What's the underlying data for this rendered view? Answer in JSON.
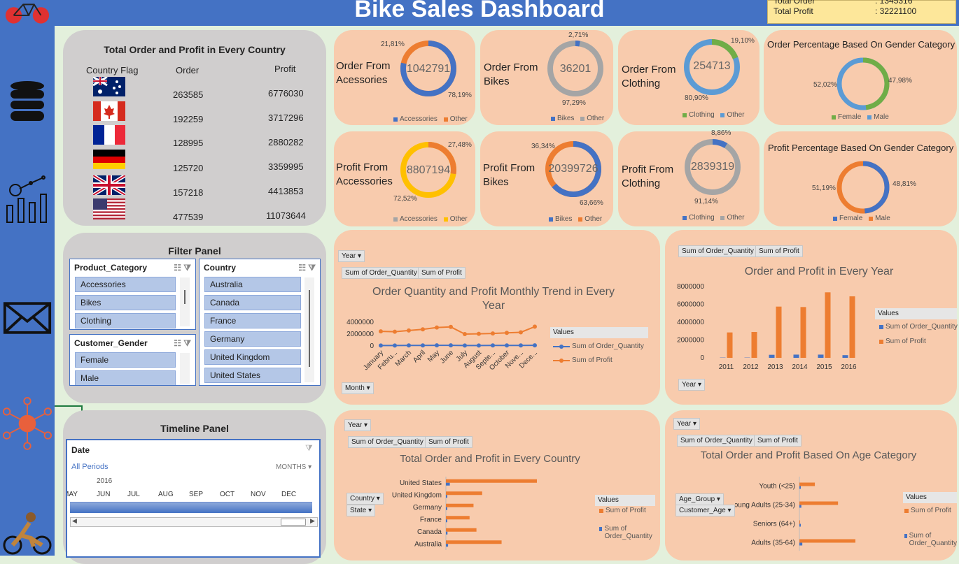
{
  "header": {
    "title": "Bike Sales Dashboard",
    "total_order_label": "Total Order",
    "total_order_value": ": 1345316",
    "total_profit_label": "Total Profit",
    "total_profit_value": ": 32221100"
  },
  "sidebar": {
    "icons": [
      "bicycle-icon",
      "database-icon",
      "analytics-chart-icon",
      "mail-icon",
      "network-icon",
      "cyclist-icon"
    ]
  },
  "country_panel": {
    "title": "Total Order and Profit in Every Country",
    "col_flag": "Country Flag",
    "col_order": "Order",
    "col_profit": "Profit",
    "rows": [
      {
        "flag": "australia",
        "order": "263585",
        "profit": "6776030"
      },
      {
        "flag": "canada",
        "order": "192259",
        "profit": "3717296"
      },
      {
        "flag": "france",
        "order": "128995",
        "profit": "2880282"
      },
      {
        "flag": "germany",
        "order": "125720",
        "profit": "3359995"
      },
      {
        "flag": "uk",
        "order": "157218",
        "profit": "4413853"
      },
      {
        "flag": "usa",
        "order": "477539",
        "profit": "11073644"
      }
    ]
  },
  "cards": {
    "order_acc": {
      "label": "Order From Acessories",
      "center": "1042791",
      "main_pct": "78,19%",
      "other_pct": "21,81%",
      "main_frac": 0.7819,
      "legend_main": "Accessories",
      "legend_other": "Other",
      "main_color": "#4472c4",
      "other_color": "#ed7d31"
    },
    "order_bikes": {
      "label": "Order From Bikes",
      "center": "36201",
      "main_pct": "2,71%",
      "other_pct": "97,29%",
      "main_frac": 0.0271,
      "legend_main": "Bikes",
      "legend_other": "Other",
      "main_color": "#4472c4",
      "other_color": "#a5a5a5"
    },
    "order_cloth": {
      "label": "Order From Clothing",
      "center": "254713",
      "main_pct": "19,10%",
      "other_pct": "80,90%",
      "main_frac": 0.191,
      "legend_main": "Clothing",
      "legend_other": "Other",
      "main_color": "#70ad47",
      "other_color": "#5b9bd5"
    },
    "order_gender": {
      "title": "Order Percentage Based On Gender Category",
      "female_pct": "47,98%",
      "male_pct": "52,02%",
      "female_frac": 0.4798,
      "legend_female": "Female",
      "legend_male": "Male",
      "female_color": "#70ad47",
      "male_color": "#5b9bd5"
    },
    "profit_acc": {
      "label": "Profit From Accessories",
      "center": "8807194",
      "main_pct": "27,48%",
      "other_pct": "72,52%",
      "main_frac": 0.2748,
      "legend_main": "Accessories",
      "legend_other": "Other",
      "main_color": "#ed7d31",
      "other_color": "#ffc000"
    },
    "profit_bikes": {
      "label": "Profit From Bikes",
      "center": "20399726",
      "main_pct": "63,66%",
      "other_pct": "36,34%",
      "main_frac": 0.6366,
      "legend_main": "Bikes",
      "legend_other": "Other",
      "main_color": "#4472c4",
      "other_color": "#ed7d31"
    },
    "profit_cloth": {
      "label": "Profit From Clothing",
      "center": "2839319",
      "main_pct": "8,86%",
      "other_pct": "91,14%",
      "main_frac": 0.0886,
      "legend_main": "Clothing",
      "legend_other": "Other",
      "main_color": "#4472c4",
      "other_color": "#a5a5a5"
    },
    "profit_gender": {
      "title": "Profit Percentage Based On Gender Category",
      "female_pct": "48,81%",
      "male_pct": "51,19%",
      "female_frac": 0.4881,
      "legend_female": "Female",
      "legend_male": "Male",
      "female_color": "#4472c4",
      "male_color": "#ed7d31"
    }
  },
  "filter_panel": {
    "title": "Filter Panel",
    "product_category": {
      "label": "Product_Category",
      "items": [
        "Accessories",
        "Bikes",
        "Clothing"
      ]
    },
    "customer_gender": {
      "label": "Customer_Gender",
      "items": [
        "Female",
        "Male"
      ]
    },
    "country": {
      "label": "Country",
      "items": [
        "Australia",
        "Canada",
        "France",
        "Germany",
        "United Kingdom",
        "United States"
      ]
    }
  },
  "timeline_panel": {
    "title": "Timeline Panel",
    "field": "Date",
    "all_periods": "All Periods",
    "unit": "MONTHS",
    "year": "2016",
    "months": [
      "MAY",
      "JUN",
      "JUL",
      "AUG",
      "SEP",
      "OCT",
      "NOV",
      "DEC"
    ]
  },
  "buttons": {
    "year": "Year",
    "month": "Month",
    "sum_qty": "Sum of Order_Quantity",
    "sum_profit": "Sum of Profit",
    "country": "Country",
    "state": "State",
    "age_group": "Age_Group",
    "customer_age": "Customer_Age",
    "values": "Values",
    "legend_qty": "Sum of Order_Quantity",
    "legend_profit": "Sum of Profit",
    "legend_qty_split": "Sum of Order_Quantity",
    "legend_qty_split_a": "Sum of",
    "legend_qty_split_b": "Order_Quantity"
  },
  "chart_data": [
    {
      "type": "line",
      "title": "Order Quantity and Profit Monthly Trend in Every Year",
      "categories": [
        "January",
        "February",
        "March",
        "April",
        "May",
        "June",
        "July",
        "August",
        "September",
        "October",
        "November",
        "December"
      ],
      "category_labels": [
        "January",
        "Febru...",
        "March",
        "April",
        "May",
        "June",
        "July",
        "August",
        "Septe...",
        "October",
        "Nove...",
        "Dece..."
      ],
      "y_ticks": [
        "4000000",
        "2000000",
        "0"
      ],
      "ylim": [
        0,
        4000000
      ],
      "series": [
        {
          "name": "Sum of Order_Quantity",
          "color": "#4472c4",
          "values": [
            80000,
            75000,
            85000,
            90000,
            100000,
            100000,
            80000,
            80000,
            85000,
            85000,
            85000,
            100000
          ]
        },
        {
          "name": "Sum of Profit",
          "color": "#ed7d31",
          "values": [
            2450000,
            2400000,
            2600000,
            2800000,
            3100000,
            3200000,
            2000000,
            2050000,
            2100000,
            2200000,
            2300000,
            3250000
          ]
        }
      ]
    },
    {
      "type": "bar",
      "title": "Order and Profit in Every Year",
      "categories": [
        "2011",
        "2012",
        "2013",
        "2014",
        "2015",
        "2016"
      ],
      "y_ticks": [
        "8000000",
        "6000000",
        "4000000",
        "2000000",
        "0"
      ],
      "ylim": [
        0,
        8000000
      ],
      "series": [
        {
          "name": "Sum of Order_Quantity",
          "color": "#4472c4",
          "values": [
            30000,
            30000,
            340000,
            360000,
            360000,
            300000
          ]
        },
        {
          "name": "Sum of Profit",
          "color": "#ed7d31",
          "values": [
            2850000,
            2900000,
            5750000,
            5700000,
            7350000,
            6900000
          ]
        }
      ]
    },
    {
      "type": "bar",
      "orientation": "horizontal",
      "title": "Total Order and Profit in Every Country",
      "categories": [
        "United States",
        "United Kingdom",
        "Germany",
        "France",
        "Canada",
        "Australia"
      ],
      "series": [
        {
          "name": "Sum of Profit",
          "color": "#ed7d31",
          "values": [
            11073644,
            4413853,
            3359995,
            2880282,
            3717296,
            6776030
          ]
        },
        {
          "name": "Sum of Order_Quantity",
          "color": "#4472c4",
          "values": [
            477539,
            157218,
            125720,
            128995,
            192259,
            263585
          ]
        }
      ]
    },
    {
      "type": "bar",
      "orientation": "horizontal",
      "title": "Total Order and Profit Based On Age Category",
      "categories": [
        "Youth (<25)",
        "Young Adults (25-34)",
        "Seniors (64+)",
        "Adults (35-64)"
      ],
      "series": [
        {
          "name": "Sum of Profit",
          "color": "#ed7d31",
          "values": [
            3200000,
            8000000,
            150000,
            11600000
          ]
        },
        {
          "name": "Sum of Order_Quantity",
          "color": "#4472c4",
          "values": [
            150000,
            400000,
            10000,
            600000
          ]
        }
      ]
    }
  ]
}
